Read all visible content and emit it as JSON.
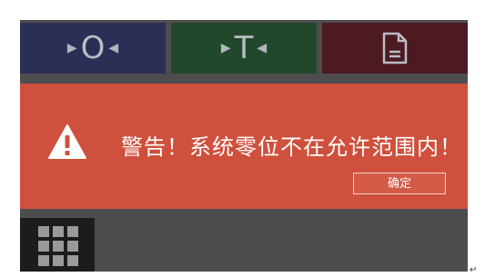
{
  "topbar": {
    "zero_letter": "O",
    "tare_letter": "T",
    "zero_icon": "triangle-right-left-icon",
    "doc_icon": "document-icon"
  },
  "alert": {
    "icon": "warning-triangle-icon",
    "message": "警告！系统零位不在允许范围内！",
    "confirm_label": "确定"
  },
  "bottombar": {
    "menu_icon": "grid-menu-icon"
  },
  "colors": {
    "zero_button": "#2b2f55",
    "tare_button": "#22482c",
    "doc_button": "#4d1a22",
    "alert_background": "#cf503c",
    "screen_background": "#4d4d4d",
    "menu_button": "#1c1c1c"
  },
  "decor": {
    "return_mark": "↵"
  }
}
